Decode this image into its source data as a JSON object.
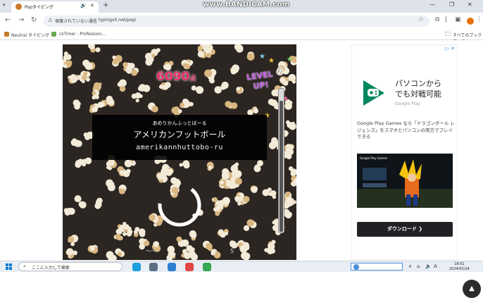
{
  "watermark": "www.BANDICAM.com",
  "browser": {
    "tab_title": "Popタイピング",
    "new_tab": "+",
    "omnibox": {
      "security_label": "保護されていない通信",
      "url": "typingx0.net/pop/"
    },
    "bookmarks": [
      {
        "label": "Neutral タイピング",
        "color": "#c77a2a"
      },
      {
        "label": "csTimer - Profession...",
        "color": "#6aa84f"
      }
    ],
    "all_bookmarks": "すべてのブックマーク"
  },
  "game": {
    "score_value": "6090",
    "score_unit": "点",
    "level_up_line1": "LEVEL",
    "level_up_line2": "UP!",
    "level_number": "7",
    "gauge_level_percent": 92,
    "word_kana": "あめりかんふっとぼーる",
    "word_kanji": "アメリカンフットボール",
    "word_romaji": "amerikannhuttobo-ru",
    "bottom_text": "〜〜　　　　　　　　　　　　　5"
  },
  "ad": {
    "controls": "▷ ✕",
    "headline_line1": "パソコンから",
    "headline_line2": "でも対戦可能",
    "brand": "Google Play",
    "description": "Google Play Games なら「ドラゴンボール レジェンズ」をスマホとパソコンの両方でプレイできる",
    "image_header": "Google Play Games",
    "button_label": "ダウンロード ❯",
    "colors": {
      "button_bg": "#202124",
      "logo_green": "#01875f"
    }
  },
  "taskbar": {
    "search_placeholder": "ここに入力して検索",
    "clock_time": "18:01",
    "clock_date": "2024/01/24",
    "apps": [
      {
        "name": "edge",
        "color": "#1f9ede"
      },
      {
        "name": "camera",
        "color": "#5b6e82"
      },
      {
        "name": "mail",
        "color": "#2f7fd1"
      },
      {
        "name": "bandicam-record",
        "color": "#e04545"
      },
      {
        "name": "chrome",
        "color": "#34a853"
      }
    ]
  }
}
